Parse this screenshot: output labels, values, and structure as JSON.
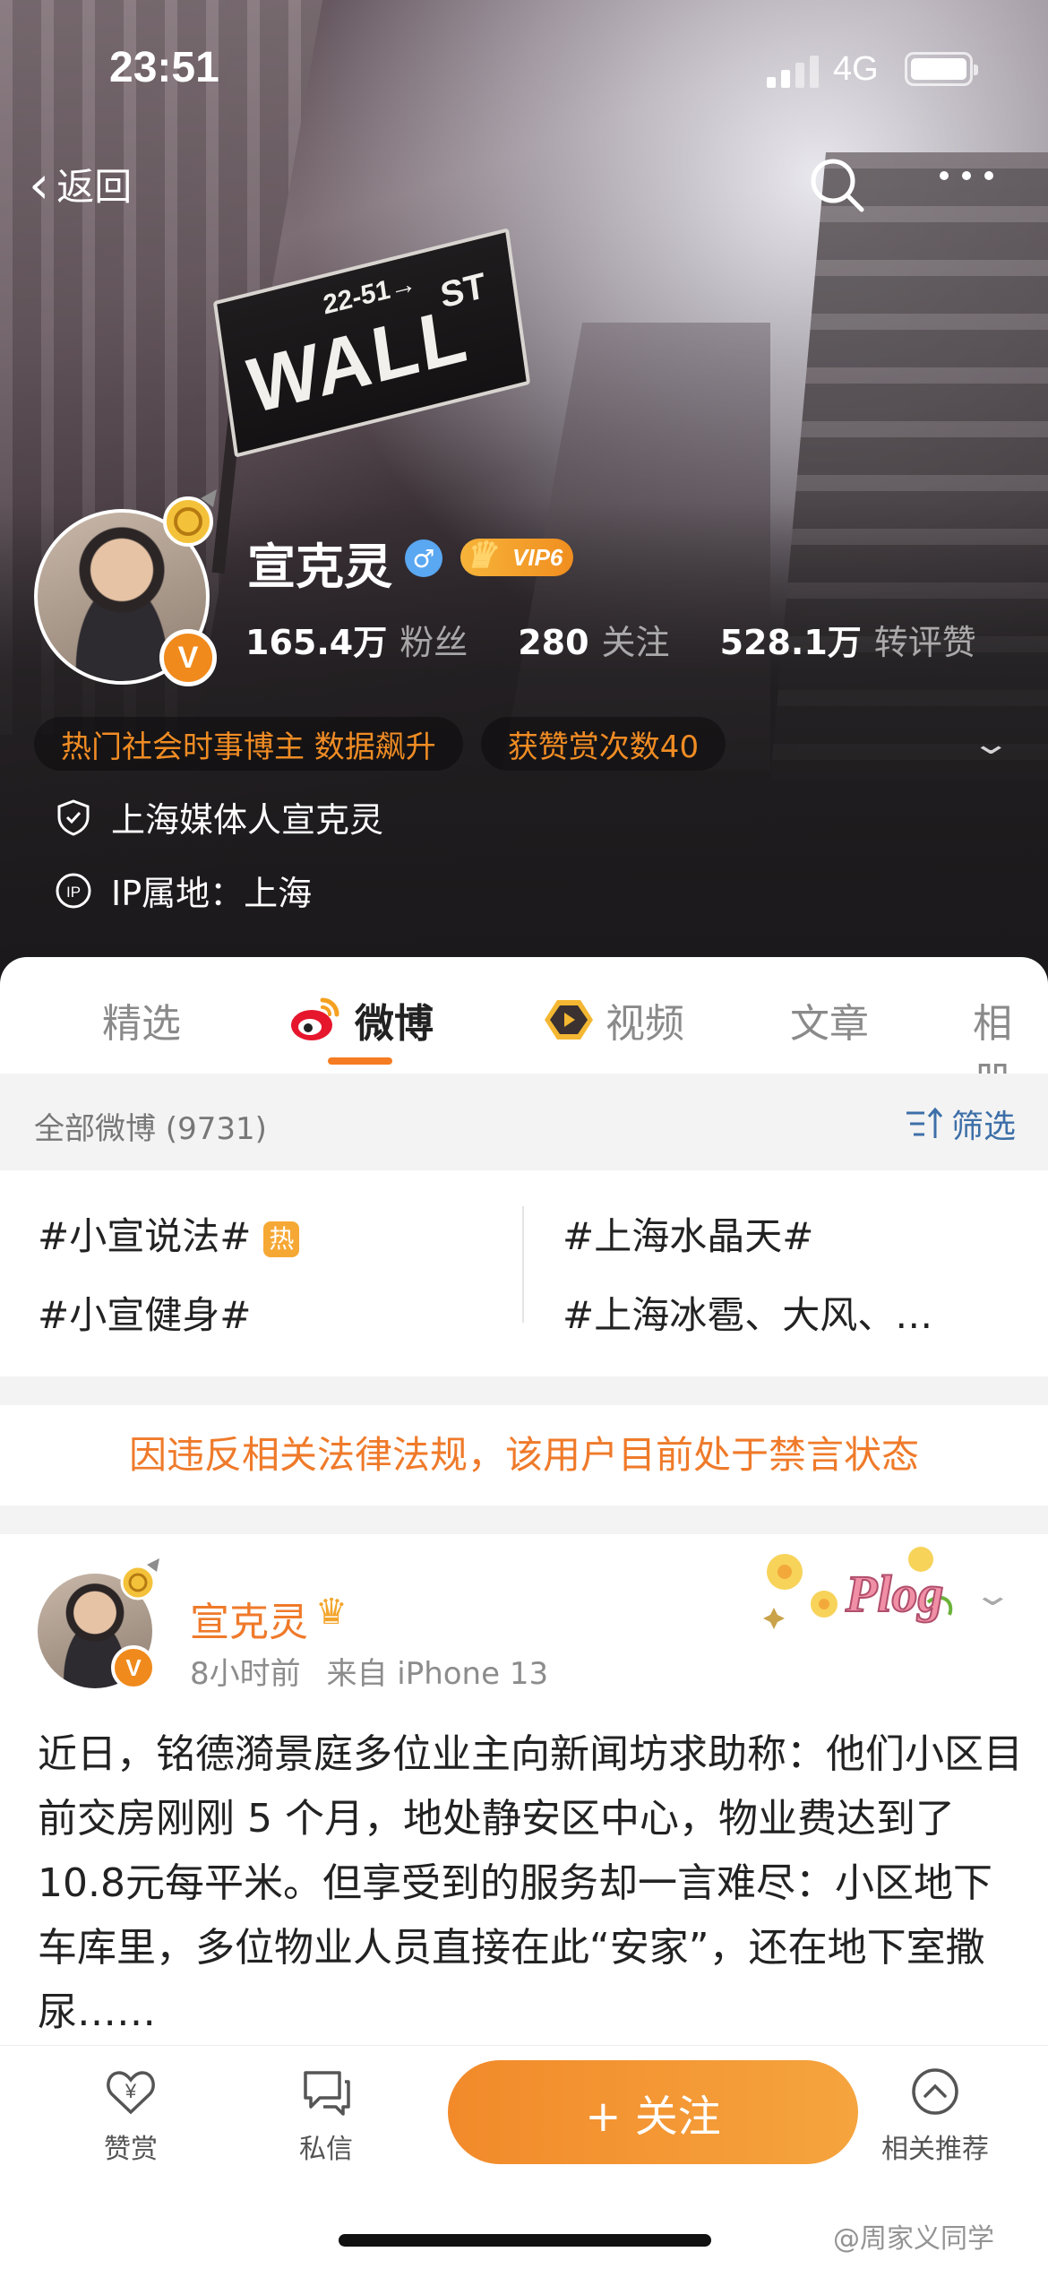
{
  "status_bar": {
    "time": "23:51",
    "network": "4G"
  },
  "nav": {
    "back_label": "返回",
    "search_icon": "search-icon",
    "more_icon": "more-icon"
  },
  "cover": {
    "sign_number": "22-51→",
    "sign_main": "WALL",
    "sign_suffix": "ST"
  },
  "profile": {
    "name": "宣克灵",
    "gender": "♂",
    "vip_label": "VIP6",
    "verified_mark": "V",
    "stats": [
      {
        "value": "165.4万",
        "label": "粉丝"
      },
      {
        "value": "280",
        "label": "关注"
      },
      {
        "value": "528.1万",
        "label": "转评赞"
      }
    ],
    "badges": [
      "热门社会时事博主 数据飙升",
      "获赞赏次数40"
    ],
    "verification": "上海媒体人宣克灵",
    "ip_location": "IP属地：上海"
  },
  "tabs": [
    {
      "label": "精选",
      "active": false
    },
    {
      "label": "微博",
      "active": true
    },
    {
      "label": "视频",
      "active": false
    },
    {
      "label": "文章",
      "active": false
    },
    {
      "label": "相册",
      "active": false
    }
  ],
  "filterbar": {
    "all_label": "全部微博 (9731)",
    "filter_label": "筛选"
  },
  "topics": [
    {
      "label": "#小宣说法#",
      "hot": "热"
    },
    {
      "label": "#上海水晶天#"
    },
    {
      "label": "#小宣健身#"
    },
    {
      "label": "#上海冰雹、大风、…"
    }
  ],
  "notice": "因违反相关法律法规，该用户目前处于禁言状态",
  "post": {
    "author": "宣克灵",
    "time": "8小时前",
    "source": "来自 iPhone 13",
    "sticker_text": "Plog",
    "text": "近日，铭德漪景庭多位业主向新闻坊求助称：他们小区目前交房刚刚 5 个月，地处静安区中心，物业费达到了10.8元每平米。但享受到的服务却一言难尽：小区地下车库里，多位物业人员直接在此“安家”，还在地下室撒尿……"
  },
  "bottom_bar": {
    "reward_label": "赞赏",
    "message_label": "私信",
    "follow_label": "+ 关注",
    "related_label": "相关推荐"
  },
  "watermark": "@周家义同学",
  "colors": {
    "accent": "#f57c22",
    "notice": "#ef7a2a",
    "link": "#3d6fa8"
  }
}
